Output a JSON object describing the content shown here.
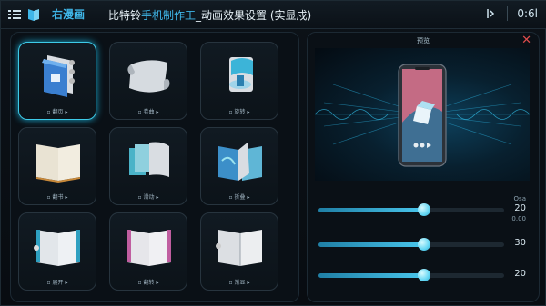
{
  "app": {
    "name": "右漫画",
    "title_part1": "比特铃",
    "title_highlight": "手机制作工",
    "title_part2": "_动画效果设置 (实显戍)",
    "right_text": "0:6l"
  },
  "colors": {
    "accent": "#3fb6e8",
    "close": "#e04c4c",
    "selected_border": "#3ecbe8"
  },
  "effects": [
    {
      "name": "翻页",
      "selected": true
    },
    {
      "name": "卷曲",
      "selected": false
    },
    {
      "name": "旋转",
      "selected": false
    },
    {
      "name": "翻书",
      "selected": false
    },
    {
      "name": "滑动",
      "selected": false
    },
    {
      "name": "折叠",
      "selected": false
    },
    {
      "name": "展开",
      "selected": false
    },
    {
      "name": "翻转",
      "selected": false
    },
    {
      "name": "渐显",
      "selected": false
    }
  ],
  "preview": {
    "title": "预览",
    "close_icon": "close-icon"
  },
  "sliders": [
    {
      "value": 20,
      "fraction": 0.57,
      "unit_top": "Osa",
      "unit_bottom": "0.00"
    },
    {
      "value": 30,
      "fraction": 0.57,
      "unit_top": "",
      "unit_bottom": ""
    },
    {
      "value": 20,
      "fraction": 0.57,
      "unit_top": "",
      "unit_bottom": ""
    }
  ]
}
